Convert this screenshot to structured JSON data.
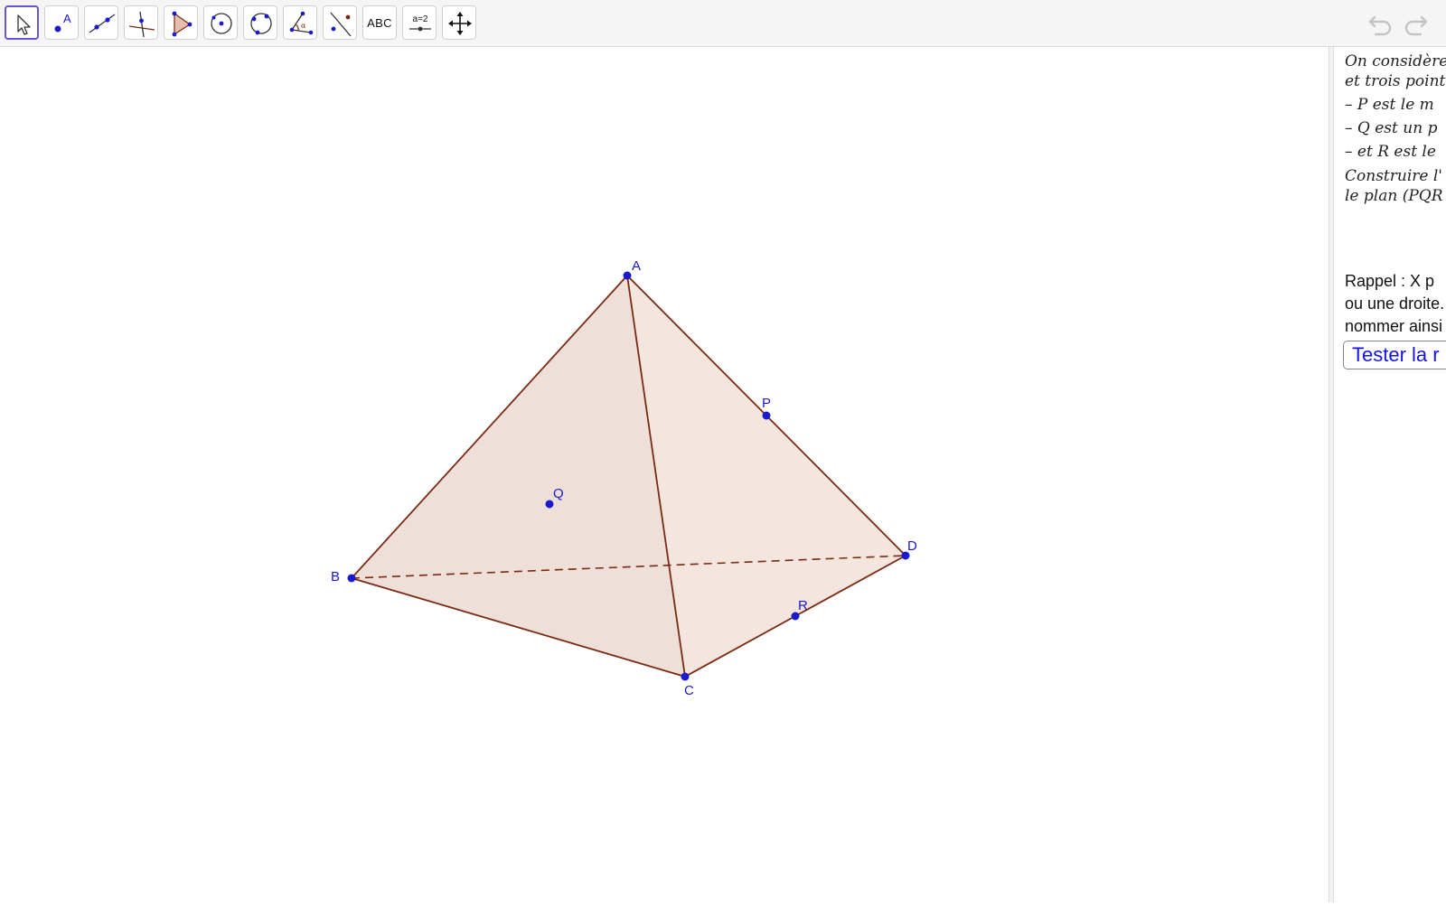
{
  "toolbar": {
    "tools": [
      {
        "name": "move",
        "icon": "pointer-arrow-icon"
      },
      {
        "name": "point",
        "icon": "point-icon",
        "label": "A"
      },
      {
        "name": "line",
        "icon": "line-through-two-points-icon"
      },
      {
        "name": "perpendicular",
        "icon": "perpendicular-line-icon"
      },
      {
        "name": "polygon",
        "icon": "polygon-icon"
      },
      {
        "name": "circle",
        "icon": "circle-center-point-icon"
      },
      {
        "name": "circle-three-points",
        "icon": "circle-three-points-icon"
      },
      {
        "name": "angle",
        "icon": "angle-icon",
        "label": "α"
      },
      {
        "name": "reflect",
        "icon": "reflect-about-line-icon"
      },
      {
        "name": "text",
        "icon": "text-icon",
        "label": "ABC"
      },
      {
        "name": "slider",
        "icon": "slider-icon",
        "label": "a=2"
      },
      {
        "name": "move-graphics",
        "icon": "move-graphics-view-icon"
      }
    ],
    "active_tool": "move",
    "undo_icon": "undo-icon",
    "redo_icon": "redo-icon"
  },
  "geometry": {
    "points": {
      "A": "A",
      "B": "B",
      "C": "C",
      "D": "D",
      "P": "P",
      "Q": "Q",
      "R": "R"
    },
    "colors": {
      "edge": "#7a2a12",
      "face": "#e8d5cc",
      "point": "#1a1acc"
    }
  },
  "panel": {
    "statement_lines": [
      "On considère",
      "et trois point",
      "– P est le m",
      "– Q est un p",
      "– et R est le",
      "Construire l'",
      "le plan (PQR"
    ],
    "reminder_lines": [
      "Rappel  :  X p",
      "ou une droite.",
      "nommer ainsi"
    ],
    "test_button_label": "Tester la r"
  }
}
